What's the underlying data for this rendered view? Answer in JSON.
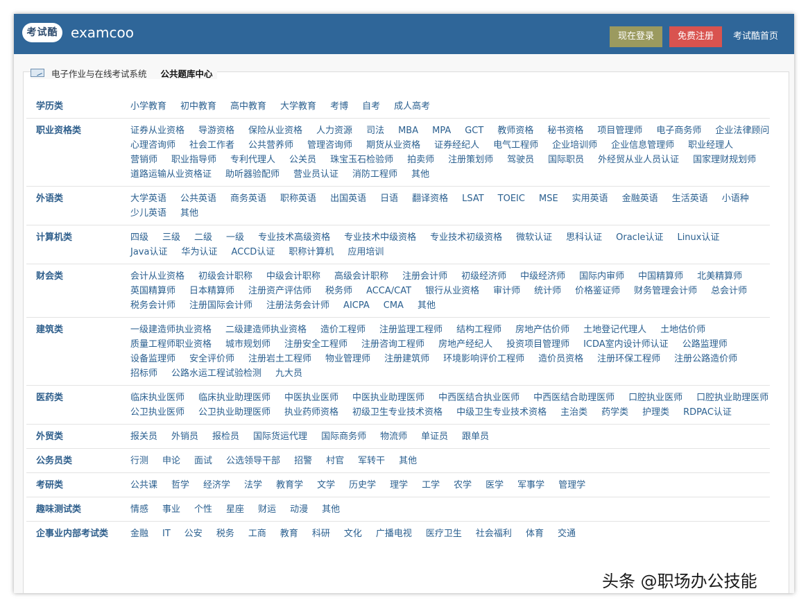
{
  "header": {
    "logo_text": "考试酷",
    "brand": "examcoo",
    "login_label": "现在登录",
    "register_label": "免费注册",
    "home_label": "考试酷首页"
  },
  "breadcrumb": {
    "system": "电子作业与在线考试系统",
    "current": "公共题库中心"
  },
  "categories": [
    {
      "name": "学历类",
      "items": [
        "小学教育",
        "初中教育",
        "高中教育",
        "大学教育",
        "考博",
        "自考",
        "成人高考"
      ]
    },
    {
      "name": "职业资格类",
      "items": [
        "证券从业资格",
        "导游资格",
        "保险从业资格",
        "人力资源",
        "司法",
        "MBA",
        "MPA",
        "GCT",
        "教师资格",
        "秘书资格",
        "项目管理师",
        "电子商务师",
        "企业法律顾问",
        "心理咨询师",
        "社会工作者",
        "公共营养师",
        "管理咨询师",
        "期货从业资格",
        "证券经纪人",
        "电气工程师",
        "企业培训师",
        "企业信息管理师",
        "职业经理人",
        "营销师",
        "职业指导师",
        "专利代理人",
        "公关员",
        "珠宝玉石检验师",
        "拍卖师",
        "注册策划师",
        "驾驶员",
        "国际职员",
        "外经贸从业人员认证",
        "国家理财规划师",
        "道路运输从业资格证",
        "助听器验配师",
        "营业员认证",
        "消防工程师",
        "其他"
      ]
    },
    {
      "name": "外语类",
      "items": [
        "大学英语",
        "公共英语",
        "商务英语",
        "职称英语",
        "出国英语",
        "日语",
        "翻译资格",
        "LSAT",
        "TOEIC",
        "MSE",
        "实用英语",
        "金融英语",
        "生活英语",
        "小语种",
        "少儿英语",
        "其他"
      ]
    },
    {
      "name": "计算机类",
      "items": [
        "四级",
        "三级",
        "二级",
        "一级",
        "专业技术高级资格",
        "专业技术中级资格",
        "专业技术初级资格",
        "微软认证",
        "思科认证",
        "Oracle认证",
        "Linux认证",
        "Java认证",
        "华为认证",
        "ACCD认证",
        "职称计算机",
        "应用培训"
      ]
    },
    {
      "name": "财会类",
      "items": [
        "会计从业资格",
        "初级会计职称",
        "中级会计职称",
        "高级会计职称",
        "注册会计师",
        "初级经济师",
        "中级经济师",
        "国际内审师",
        "中国精算师",
        "北美精算师",
        "英国精算师",
        "日本精算师",
        "注册资产评估师",
        "税务师",
        "ACCA/CAT",
        "银行从业资格",
        "审计师",
        "统计师",
        "价格鉴证师",
        "财务管理会计师",
        "总会计师",
        "税务会计师",
        "注册国际会计师",
        "注册法务会计师",
        "AICPA",
        "CMA",
        "其他"
      ]
    },
    {
      "name": "建筑类",
      "items": [
        "一级建造师执业资格",
        "二级建造师执业资格",
        "造价工程师",
        "注册监理工程师",
        "结构工程师",
        "房地产估价师",
        "土地登记代理人",
        "土地估价师",
        "质量工程师职业资格",
        "城市规划师",
        "注册安全工程师",
        "注册咨询工程师",
        "房地产经纪人",
        "投资项目管理师",
        "ICDA室内设计师认证",
        "公路监理师",
        "设备监理师",
        "安全评价师",
        "注册岩土工程师",
        "物业管理师",
        "注册建筑师",
        "环境影响评价工程师",
        "造价员资格",
        "注册环保工程师",
        "注册公路造价师",
        "招标师",
        "公路水运工程试验检测",
        "九大员"
      ]
    },
    {
      "name": "医药类",
      "items": [
        "临床执业医师",
        "临床执业助理医师",
        "中医执业医师",
        "中医执业助理医师",
        "中西医结合执业医师",
        "中西医结合助理医师",
        "口腔执业医师",
        "口腔执业助理医师",
        "公卫执业医师",
        "公卫执业助理医师",
        "执业药师资格",
        "初级卫生专业技术资格",
        "中级卫生专业技术资格",
        "主治类",
        "药学类",
        "护理类",
        "RDPAC认证"
      ]
    },
    {
      "name": "外贸类",
      "items": [
        "报关员",
        "外销员",
        "报检员",
        "国际货运代理",
        "国际商务师",
        "物流师",
        "单证员",
        "跟单员"
      ]
    },
    {
      "name": "公务员类",
      "items": [
        "行测",
        "申论",
        "面试",
        "公选领导干部",
        "招警",
        "村官",
        "军转干",
        "其他"
      ]
    },
    {
      "name": "考研类",
      "items": [
        "公共课",
        "哲学",
        "经济学",
        "法学",
        "教育学",
        "文学",
        "历史学",
        "理学",
        "工学",
        "农学",
        "医学",
        "军事学",
        "管理学"
      ]
    },
    {
      "name": "趣味测试类",
      "items": [
        "情感",
        "事业",
        "个性",
        "星座",
        "财运",
        "动漫",
        "其他"
      ]
    },
    {
      "name": "企事业内部考试类",
      "items": [
        "金融",
        "IT",
        "公安",
        "税务",
        "工商",
        "教育",
        "科研",
        "文化",
        "广播电视",
        "医疗卫生",
        "社会福利",
        "体育",
        "交通"
      ]
    }
  ],
  "watermark": "头条 @职场办公技能"
}
